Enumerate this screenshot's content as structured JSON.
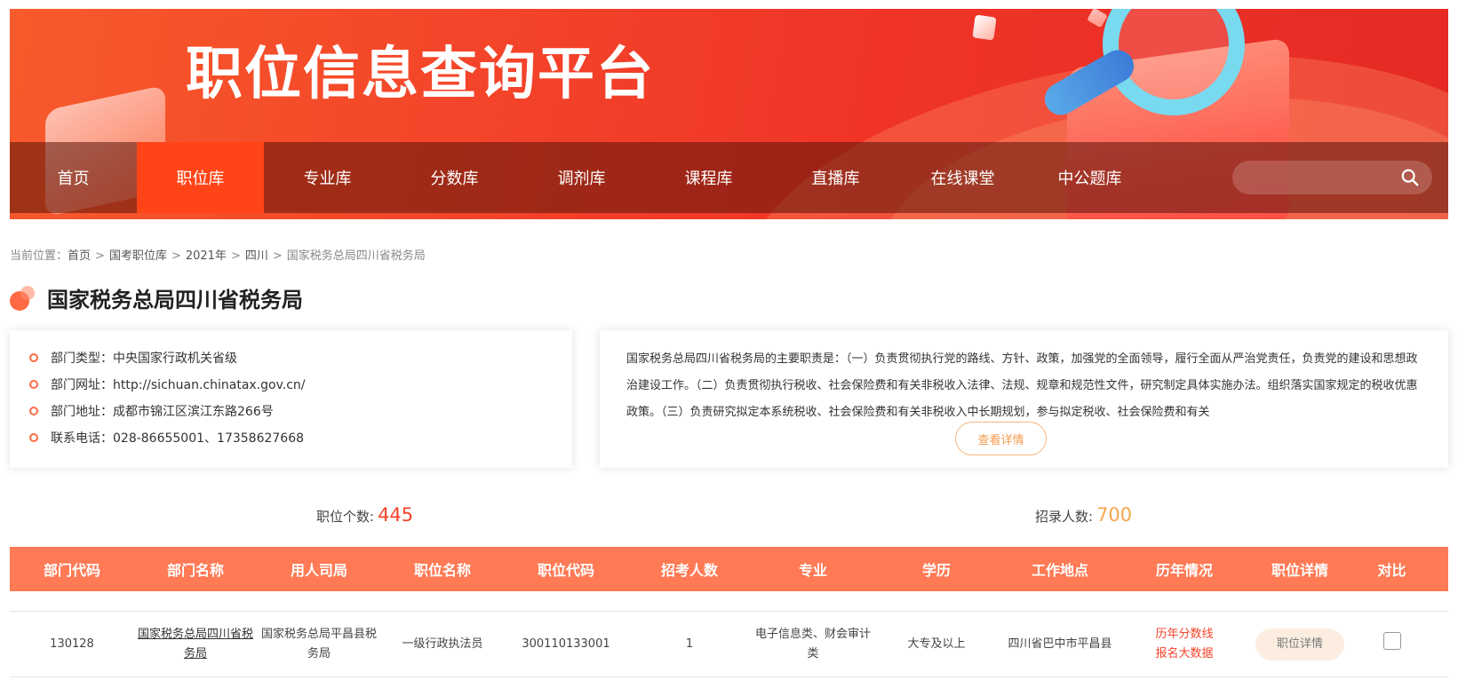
{
  "banner": {
    "title": "职位信息查询平台"
  },
  "nav": {
    "items": [
      "首页",
      "职位库",
      "专业库",
      "分数库",
      "调剂库",
      "课程库",
      "直播库",
      "在线课堂",
      "中公题库"
    ],
    "active_index": 1,
    "search_icon": "search-icon"
  },
  "breadcrumb": {
    "prefix": "当前位置：",
    "items": [
      "首页",
      "国考职位库",
      "2021年",
      "四川",
      "国家税务总局四川省税务局"
    ],
    "separator": ">"
  },
  "department": {
    "name": "国家税务总局四川省税务局",
    "info": [
      "部门类型：中央国家行政机关省级",
      "部门网址：http://sichuan.chinatax.gov.cn/",
      "部门地址：成都市锦江区滨江东路266号",
      "联系电话：028-86655001、17358627668"
    ],
    "description": "国家税务总局四川省税务局的主要职责是：（一）负责贯彻执行党的路线、方针、政策，加强党的全面领导，履行全面从严治党责任，负责党的建设和思想政治建设工作。（二）负责贯彻执行税收、社会保险费和有关非税收入法律、法规、规章和规范性文件，研究制定具体实施办法。组织落实国家规定的税收优惠政策。（三）负责研究拟定本系统税收、社会保险费和有关非税收入中长期规划，参与拟定税收、社会保险费和有关",
    "detail_button": "查看详情"
  },
  "stats": {
    "positions_label": "职位个数:",
    "positions_value": "445",
    "recruits_label": "招录人数:",
    "recruits_value": "700"
  },
  "table": {
    "headers": [
      "部门代码",
      "部门名称",
      "用人司局",
      "职位名称",
      "职位代码",
      "招考人数",
      "专业",
      "学历",
      "工作地点",
      "历年情况",
      "职位详情",
      "对比"
    ],
    "rows": [
      {
        "dept_code": "130128",
        "dept_name": "国家税务总局四川省税务局",
        "bureau": "国家税务总局平昌县税务局",
        "position": "一级行政执法员",
        "position_code": "300110133001",
        "count": "1",
        "major": "电子信息类、财会审计类",
        "education": "大专及以上",
        "location": "四川省巴中市平昌县",
        "history_line1": "历年分数线",
        "history_line2": "报名大数据",
        "detail_button": "职位详情"
      }
    ]
  },
  "colors": {
    "accent": "#ff4518",
    "header": "#ff7a55",
    "red_text": "#f5432a",
    "orange_text": "#f5a64c"
  }
}
